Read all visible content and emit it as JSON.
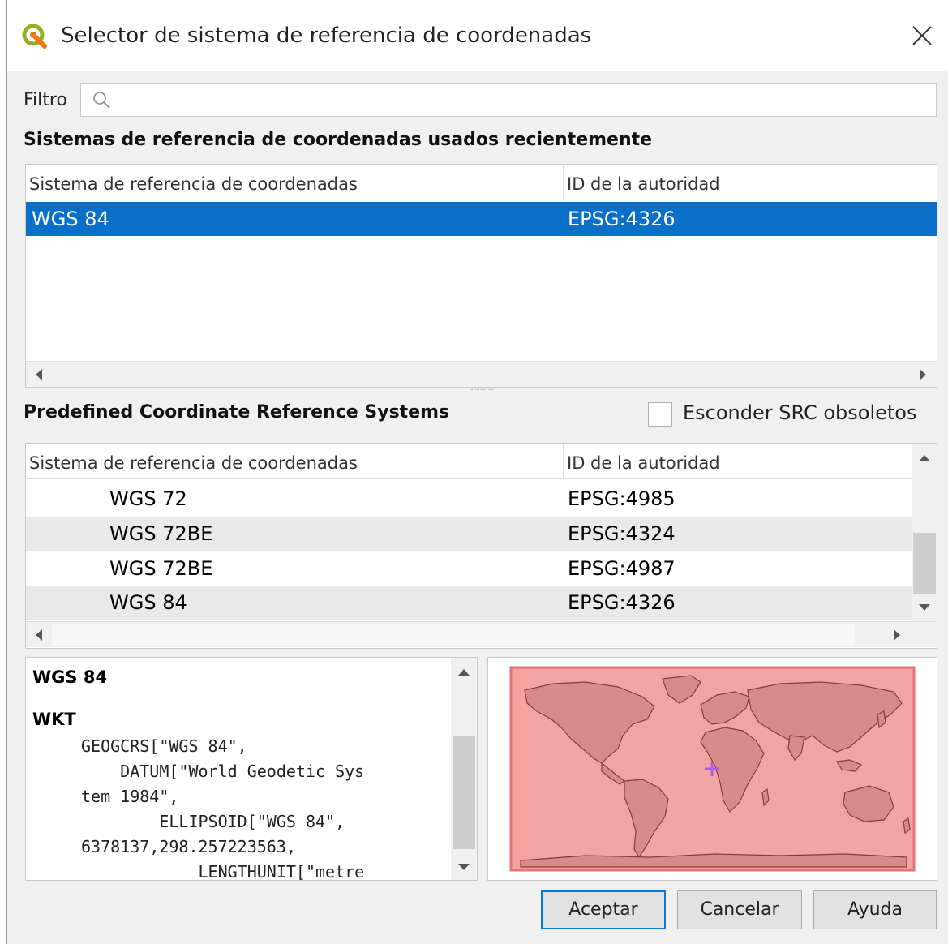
{
  "dialog": {
    "title": "Selector de sistema de referencia de coordenadas"
  },
  "filter": {
    "label": "Filtro",
    "value": "",
    "placeholder": ""
  },
  "recent": {
    "title": "Sistemas de referencia de coordenadas usados recientemente",
    "columns": [
      "Sistema de referencia de coordenadas",
      "ID de la autoridad"
    ],
    "rows": [
      {
        "name": "WGS 84",
        "id": "EPSG:4326",
        "selected": true
      }
    ]
  },
  "predefined": {
    "title": "Predefined Coordinate Reference Systems",
    "hide_deprecated_label": "Esconder SRC obsoletos",
    "hide_deprecated_checked": false,
    "columns": [
      "Sistema de referencia de coordenadas",
      "ID de la autoridad"
    ],
    "rows": [
      {
        "name": "WGS 72",
        "id": "EPSG:4985"
      },
      {
        "name": "WGS 72BE",
        "id": "EPSG:4324"
      },
      {
        "name": "WGS 72BE",
        "id": "EPSG:4987"
      },
      {
        "name": "WGS 84",
        "id": "EPSG:4326"
      }
    ]
  },
  "details": {
    "crs_name": "WGS 84",
    "wkt_label": "WKT",
    "wkt_lines": [
      "GEOGCRS[\"WGS 84\",",
      "    DATUM[\"World Geodetic Sys",
      "tem 1984\",",
      "        ELLIPSOID[\"WGS 84\",",
      "6378137,298.257223563,",
      "            LENGTHUNIT[\"metre"
    ]
  },
  "buttons": {
    "ok": "Aceptar",
    "cancel": "Cancelar",
    "help": "Ayuda"
  },
  "colors": {
    "selection": "#0a6fc9",
    "extent_fill": "#f4a3a3",
    "extent_border": "#e57373",
    "marker": "#b05fe0"
  }
}
